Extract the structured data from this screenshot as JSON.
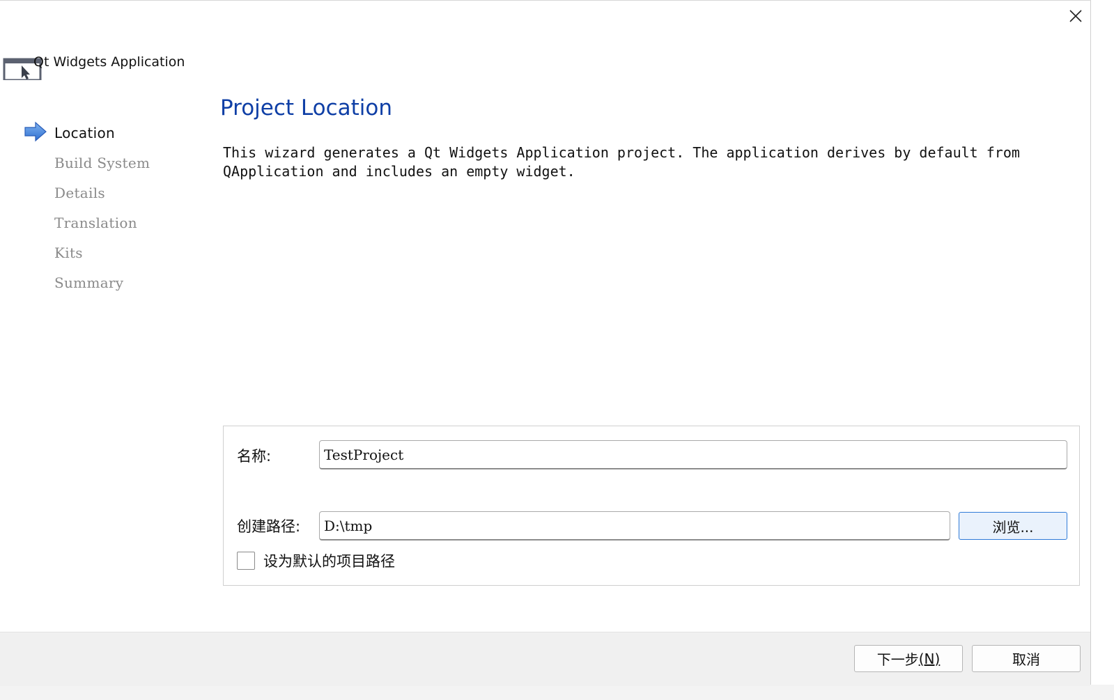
{
  "window": {
    "title": "Qt Widgets Application",
    "close_icon": "close-icon"
  },
  "nav": {
    "items": [
      {
        "label": "Location",
        "active": true
      },
      {
        "label": "Build System",
        "active": false
      },
      {
        "label": "Details",
        "active": false
      },
      {
        "label": "Translation",
        "active": false
      },
      {
        "label": "Kits",
        "active": false
      },
      {
        "label": "Summary",
        "active": false
      }
    ]
  },
  "page": {
    "title": "Project Location",
    "description": "This wizard generates a Qt Widgets Application project. The application derives by default from QApplication and includes an empty widget."
  },
  "form": {
    "name_label": "名称:",
    "name_value": "TestProject",
    "path_label": "创建路径:",
    "path_value": "D:\\tmp",
    "browse_label": "浏览...",
    "default_path_label": "设为默认的项目路径",
    "default_path_checked": false
  },
  "footer": {
    "next_label": "下一步",
    "next_mnemonic": "(N)",
    "cancel_label": "取消"
  },
  "colors": {
    "title_blue": "#0f3fa6",
    "accent_blue": "#2f7bd8"
  }
}
